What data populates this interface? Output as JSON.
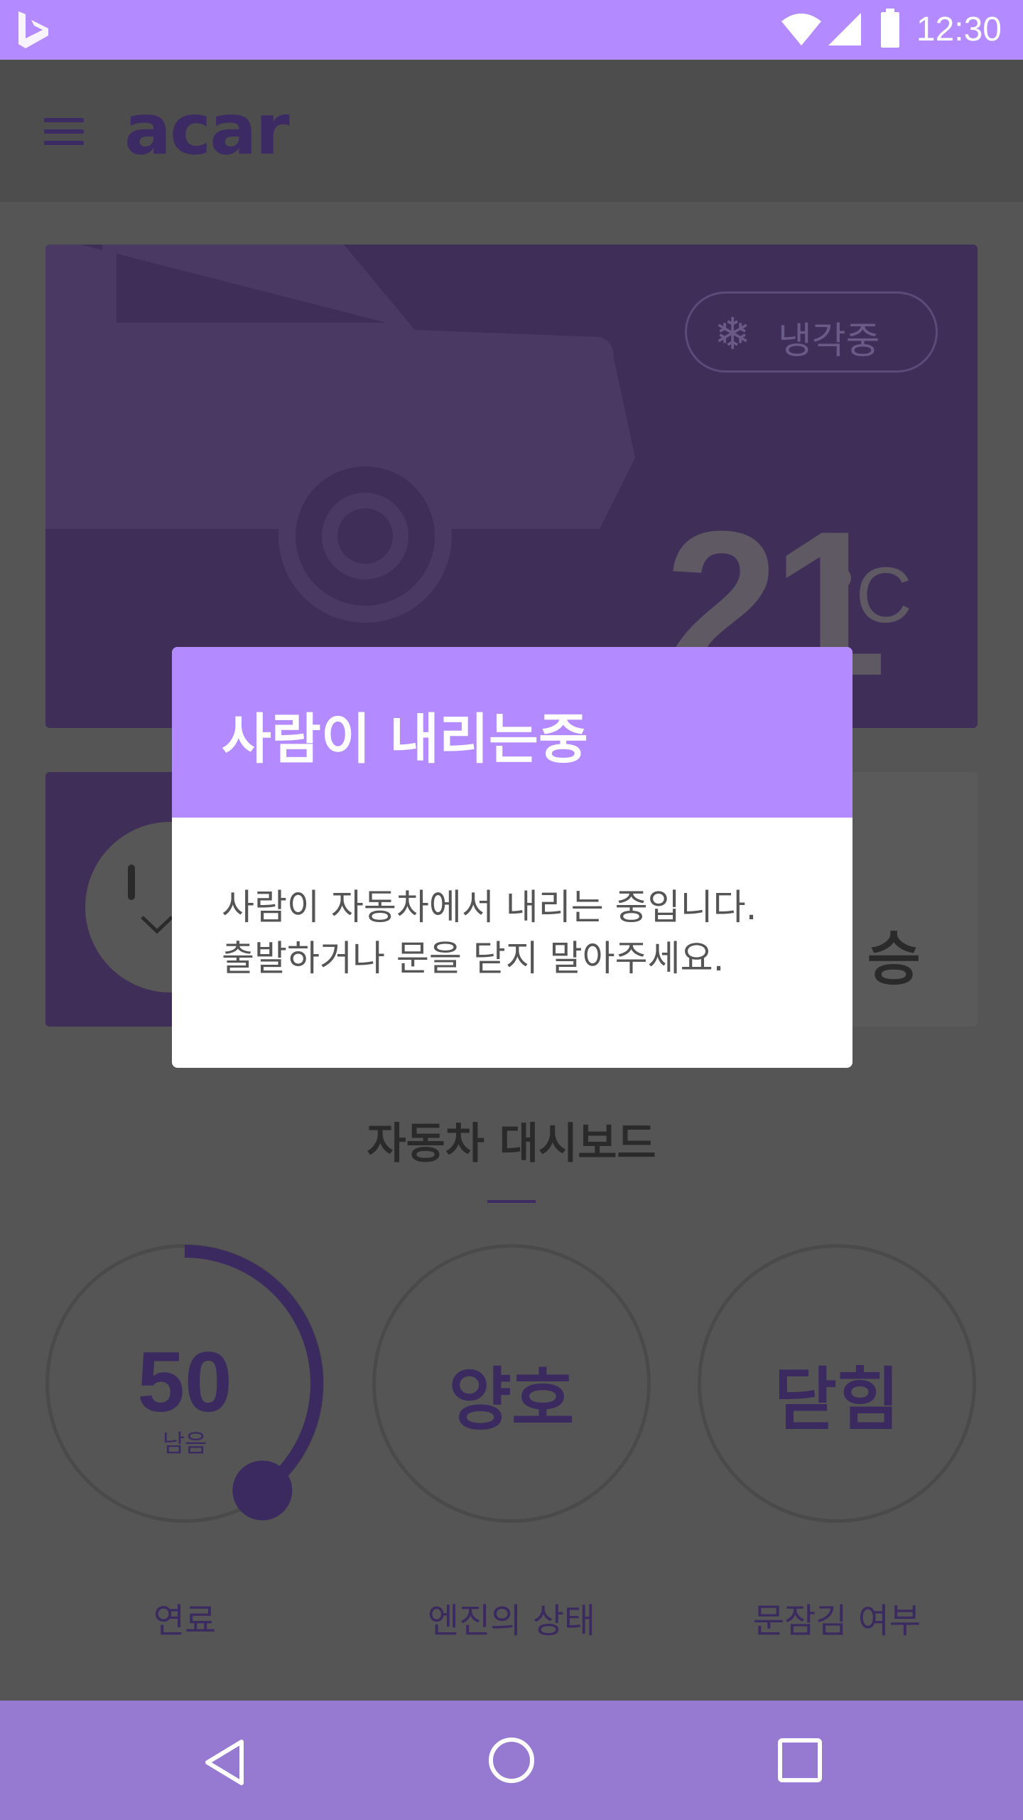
{
  "status_bar": {
    "time": "12:30",
    "background": "#b38aff"
  },
  "app_bar": {
    "logo_text": "acar"
  },
  "temperature_card": {
    "badge_label": "냉각중",
    "temperature": "21",
    "unit": "°C"
  },
  "boarding_card": {
    "label_partial": "승"
  },
  "dashboard": {
    "title": "자동차 대시보드",
    "gauges": [
      {
        "value": "50",
        "sub_label": "남음",
        "caption": "연료",
        "progress": 0.4
      },
      {
        "value": "양호",
        "caption": "엔진의 상태"
      },
      {
        "value": "닫힘",
        "caption": "문잠김 여부"
      }
    ]
  },
  "dialog": {
    "title": "사람이 내리는중",
    "message_line1": "사람이 자동차에서 내리는 중입니다.",
    "message_line2": "출발하거나 문을 닫지 말아주세요.",
    "accent": "#b38aff"
  },
  "nav_bar": {
    "background": "#9679d1"
  }
}
